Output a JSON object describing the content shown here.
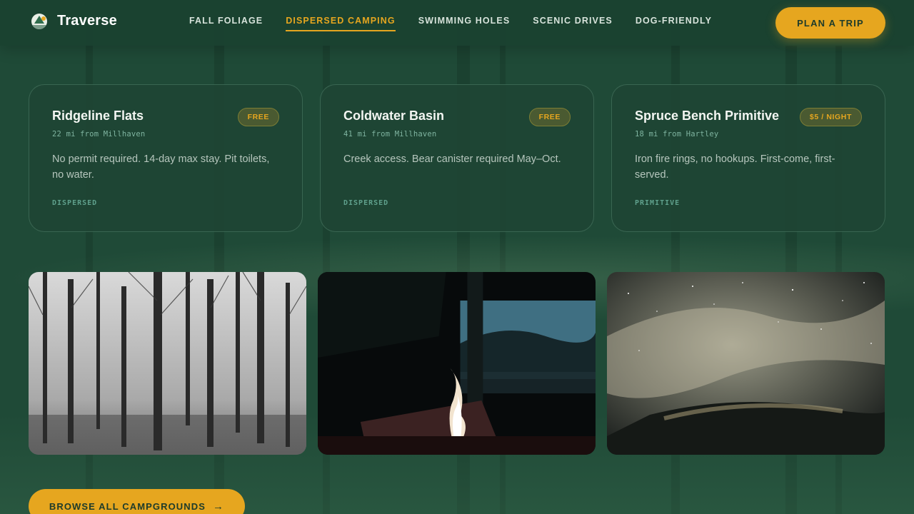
{
  "brand": {
    "name": "Traverse",
    "logo_icon": "mountain-logo-icon"
  },
  "nav": {
    "items": [
      {
        "label": "FALL FOLIAGE",
        "active": false
      },
      {
        "label": "DISPERSED CAMPING",
        "active": true
      },
      {
        "label": "SWIMMING HOLES",
        "active": false
      },
      {
        "label": "SCENIC DRIVES",
        "active": false
      },
      {
        "label": "DOG-FRIENDLY",
        "active": false
      }
    ],
    "cta_label": "PLAN A TRIP"
  },
  "campsites": [
    {
      "name": "Ridgeline Flats",
      "distance": "22 mi from Millhaven",
      "price": "FREE",
      "description": "No permit required. 14-day max stay. Pit toilets, no water.",
      "type": "DISPERSED"
    },
    {
      "name": "Coldwater Basin",
      "distance": "41 mi from Millhaven",
      "price": "FREE",
      "description": "Creek access. Bear canister required May–Oct.",
      "type": "DISPERSED"
    },
    {
      "name": "Spruce Bench Primitive",
      "distance": "18 mi from Hartley",
      "price": "$5 / NIGHT",
      "description": "Iron fire rings, no hookups. First-come, first-served.",
      "type": "PRIMITIVE"
    }
  ],
  "gallery": [
    {
      "subject": "forest-photo"
    },
    {
      "subject": "campfire-photo"
    },
    {
      "subject": "night-sky-photo"
    }
  ],
  "browse": {
    "label": "BROWSE ALL CAMPGROUNDS",
    "icon": "arrow-right-icon"
  },
  "colors": {
    "background": "#1f4a37",
    "accent": "#e6a61f",
    "card": "#1e4434",
    "tag": "#5fa08c"
  }
}
